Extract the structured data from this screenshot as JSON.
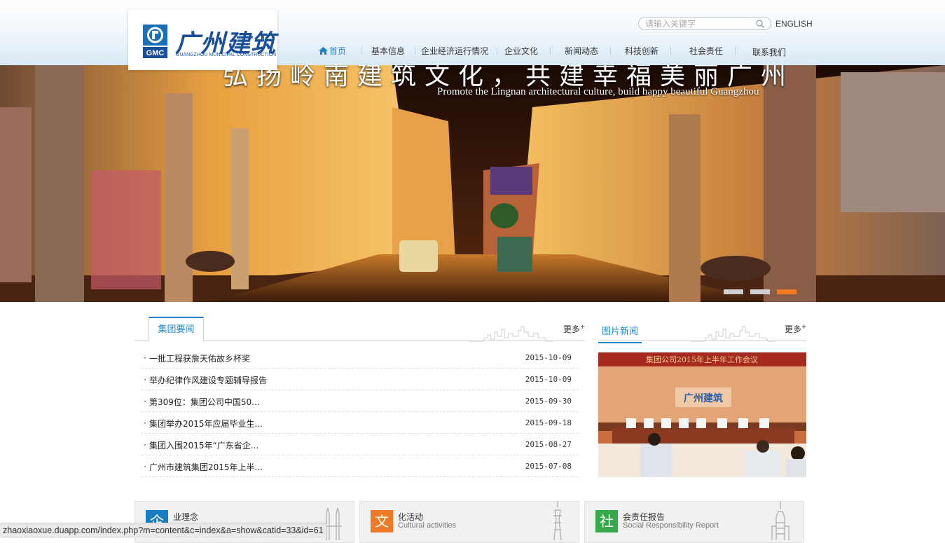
{
  "header": {
    "logo_cn": "广州建筑",
    "logo_en": "GUANGZHOU MUNICIPAL CONSTRUCTION",
    "logo_mark": "GMC",
    "search_placeholder": "请输入关键字",
    "english_label": "ENGLISH",
    "nav": [
      {
        "label": "首页",
        "active": true
      },
      {
        "label": "基本信息"
      },
      {
        "label": "企业经济运行情况"
      },
      {
        "label": "企业文化"
      },
      {
        "label": "新闻动态"
      },
      {
        "label": "科技创新"
      },
      {
        "label": "社会责任"
      },
      {
        "label": "联系我们"
      }
    ]
  },
  "banner": {
    "slogan_cn": "弘扬岭南建筑文化，共建幸福美丽广州",
    "slogan_en": "Promote the Lingnan architectural culture, build happy beautiful Guangzhou",
    "slides": 3,
    "active_slide": 3,
    "accent_color": "#f07a1e"
  },
  "news": {
    "tab_label": "集团要闻",
    "more_label": "更多",
    "items": [
      {
        "title": "一批工程获詹天佑故乡杯奖",
        "date": "2015-10-09"
      },
      {
        "title": "举办纪律作风建设专题辅导报告",
        "date": "2015-10-09"
      },
      {
        "title": "第309位：集团公司中国50...",
        "date": "2015-09-30"
      },
      {
        "title": "集团举办2015年应届毕业生...",
        "date": "2015-09-18"
      },
      {
        "title": "集团入围2015年“广东省企...",
        "date": "2015-08-27"
      },
      {
        "title": "广州市建筑集团2015年上半...",
        "date": "2015-07-08"
      }
    ]
  },
  "photo_news": {
    "tab_label": "图片新闻",
    "more_label": "更多",
    "banner_text": "集团公司2015年上半年工作会议",
    "logo_text": "广州建筑"
  },
  "cards": [
    {
      "icon_char": "企",
      "title": "业理念",
      "subtitle": "",
      "icon_color": "#1a7cc1"
    },
    {
      "icon_char": "文",
      "title": "化活动",
      "subtitle": "Cultural activities",
      "icon_color": "#ee7a26"
    },
    {
      "icon_char": "社",
      "title": "会责任报告",
      "subtitle": "Social Responsibility Report",
      "icon_color": "#35a84a"
    }
  ],
  "status_url": "zhaoxiaoxue.duapp.com/index.php?m=content&c=index&a=show&catid=33&id=61",
  "colors": {
    "primary_blue": "#1e88c8",
    "brand_blue": "#1a4f9c"
  }
}
